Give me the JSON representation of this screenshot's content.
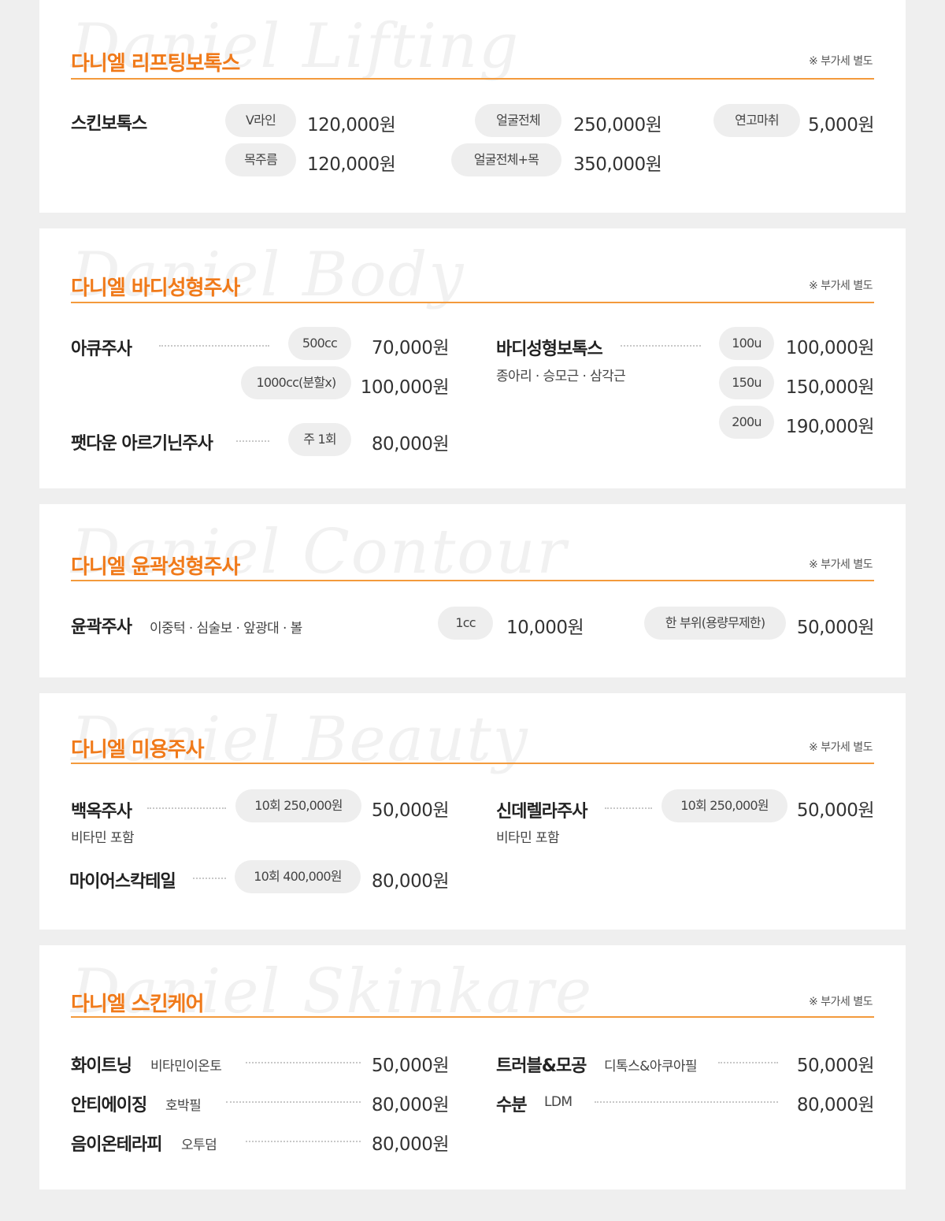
{
  "vat_note": "※ 부가세 별도",
  "lifting": {
    "watermark": "Daniel Lifting",
    "title": "다니엘 리프팅보톡스",
    "item": "스킨보톡스",
    "rows": [
      {
        "label": "V라인",
        "price": "120,000원"
      },
      {
        "label": "목주름",
        "price": "120,000원"
      },
      {
        "label": "얼굴전체",
        "price": "250,000원"
      },
      {
        "label": "얼굴전체+목",
        "price": "350,000원"
      },
      {
        "label": "연고마취",
        "price": "5,000원"
      }
    ]
  },
  "body": {
    "watermark": "Daniel Body",
    "title": "다니엘 바디성형주사",
    "aqua": {
      "name": "아큐주사",
      "opts": [
        {
          "label": "500cc",
          "price": "70,000원"
        },
        {
          "label": "1000cc(분할x)",
          "price": "100,000원"
        }
      ]
    },
    "fatdown": {
      "name": "팻다운 아르기닌주사",
      "label": "주 1회",
      "price": "80,000원"
    },
    "botox": {
      "name": "바디성형보톡스",
      "sub": "종아리 · 승모근 · 삼각근",
      "opts": [
        {
          "label": "100u",
          "price": "100,000원"
        },
        {
          "label": "150u",
          "price": "150,000원"
        },
        {
          "label": "200u",
          "price": "190,000원"
        }
      ]
    }
  },
  "contour": {
    "watermark": "Daniel Contour",
    "title": "다니엘 윤곽성형주사",
    "name": "윤곽주사",
    "sub": "이중턱 · 심술보 · 앞광대 · 볼",
    "opts": [
      {
        "label": "1cc",
        "price": "10,000원"
      },
      {
        "label": "한 부위(용량무제한)",
        "price": "50,000원"
      }
    ]
  },
  "beauty": {
    "watermark": "Daniel Beauty",
    "title": "다니엘 미용주사",
    "items": [
      {
        "name": "백옥주사",
        "sub": "비타민 포함",
        "label": "10회 250,000원",
        "price": "50,000원"
      },
      {
        "name": "신데렐라주사",
        "sub": "비타민 포함",
        "label": "10회 250,000원",
        "price": "50,000원"
      },
      {
        "name": "마이어스칵테일",
        "label": "10회 400,000원",
        "price": "80,000원"
      }
    ]
  },
  "skincare": {
    "watermark": "Daniel Skinkare",
    "title": "다니엘 스킨케어",
    "items": [
      {
        "name": "화이트닝",
        "sub": "비타민이온토",
        "price": "50,000원"
      },
      {
        "name": "안티에이징",
        "sub": "호박필",
        "price": "80,000원"
      },
      {
        "name": "음이온테라피",
        "sub": "오투덤",
        "price": "80,000원"
      },
      {
        "name": "트러블&모공",
        "sub": "디톡스&아쿠아필",
        "price": "50,000원"
      },
      {
        "name": "수분",
        "sub": "LDM",
        "price": "80,000원"
      }
    ]
  }
}
